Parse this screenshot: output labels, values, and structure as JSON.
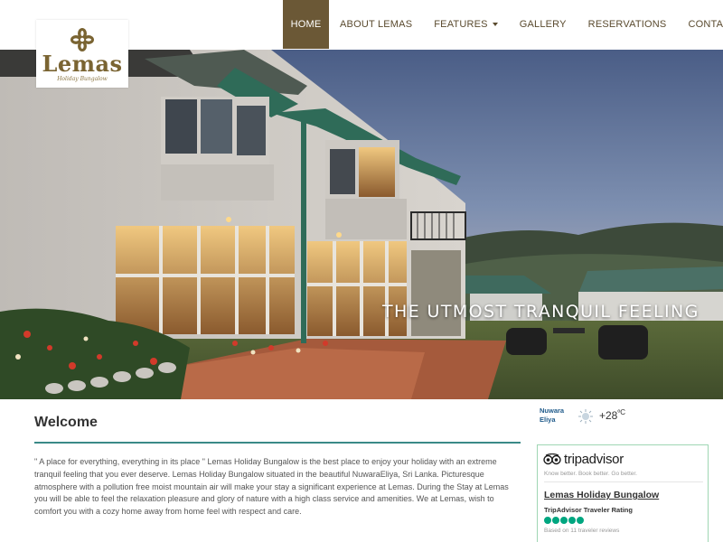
{
  "nav": {
    "items": [
      {
        "label": "HOME",
        "active": true
      },
      {
        "label": "ABOUT LEMAS"
      },
      {
        "label": "FEATURES",
        "dropdown": true
      },
      {
        "label": "GALLERY"
      },
      {
        "label": "RESERVATIONS"
      },
      {
        "label": "CONTACT US"
      }
    ]
  },
  "logo": {
    "name": "Lemas",
    "subtitle": "Holiday Bungalow",
    "icon": "clover-icon"
  },
  "hero": {
    "caption": "THE UTMOST TRANQUIL FEELING"
  },
  "welcome": {
    "title": "Welcome",
    "text": "\" A place for everything, everything in its place \" Lemas Holiday Bungalow is the best place to enjoy your holiday with an extreme tranquil feeling that you ever deserve. Lemas Holiday Bungalow situated in the beautiful NuwaraEliya, Sri Lanka. Picturesque atmosphere with a pollution free moist mountain air will make your stay a significant experience at Lemas. During the Stay at Lemas you will be able to feel the relaxation pleasure and glory of nature with a high class service and amenities. We at Lemas, wish to comfort you with a cozy home away from home feel with respect and care."
  },
  "weather": {
    "city": "Nuwara Eliya",
    "temp": "+28",
    "unit": "ºC",
    "icon": "cloudy-weather-icon"
  },
  "tripadvisor": {
    "brand": "tripadvisor",
    "tagline": "Know better. Book better. Go better.",
    "property_name": "Lemas Holiday Bungalow",
    "rating_label": "TripAdvisor Traveler Rating",
    "rating": 5,
    "based_on": "Based on 11 traveler reviews",
    "accent_color": "#00a680"
  },
  "colors": {
    "brand": "#6b5836",
    "accent": "#3a8a87"
  }
}
